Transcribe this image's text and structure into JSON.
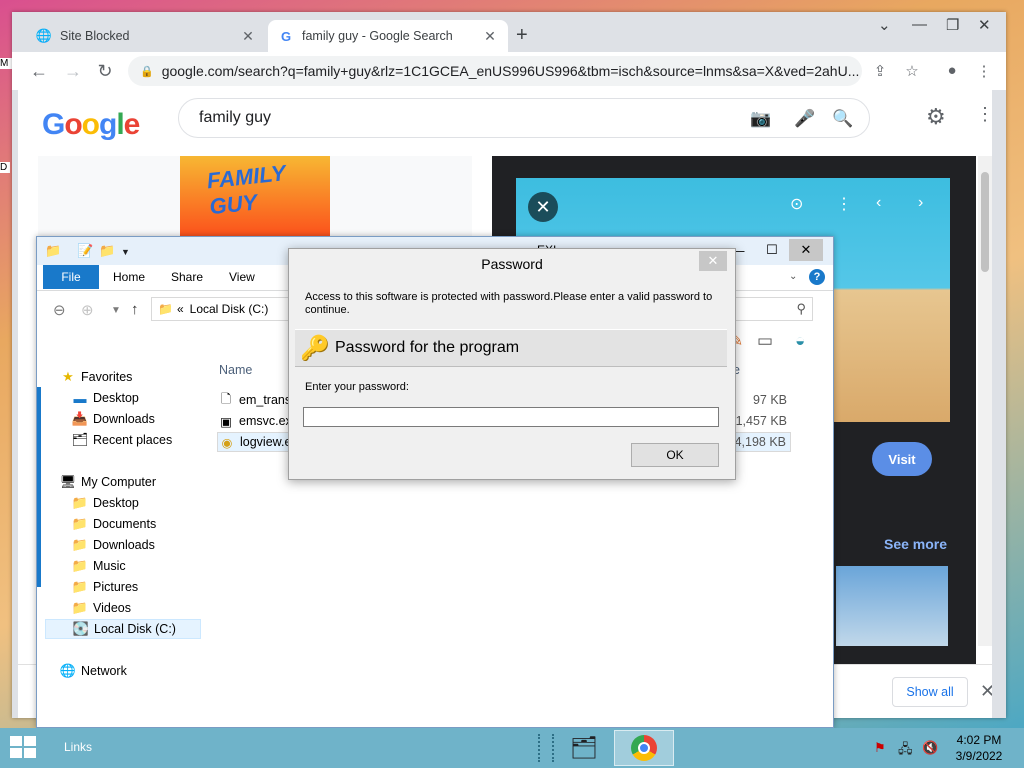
{
  "desktop": {
    "edge_letter_top": "M",
    "edge_letter_mid": "D"
  },
  "chrome": {
    "tabs": [
      {
        "title": "Site Blocked",
        "icon": "globe-icon"
      },
      {
        "title": "family guy - Google Search",
        "icon": "google-g-icon"
      }
    ],
    "url": "google.com/search?q=family+guy&rlz=1C1GCEA_enUS996US996&tbm=isch&source=lnms&sa=X&ved=2ahU...",
    "google_logo": "Google",
    "search_query": "family guy",
    "thumbnail_text": "FAMILY GUY",
    "visit_label": "Visit",
    "see_more_label": "See more",
    "show_all_label": "Show all"
  },
  "explorer": {
    "title_partial": "EXI",
    "ribbon_tabs": [
      "File",
      "Home",
      "Share",
      "View"
    ],
    "address": "Local Disk (C:)",
    "address_prefix": "«",
    "columns": {
      "name": "Name",
      "right": "e"
    },
    "nav": {
      "favorites": "Favorites",
      "fav_items": [
        "Desktop",
        "Downloads",
        "Recent places"
      ],
      "computer": "My Computer",
      "computer_items": [
        "Desktop",
        "Documents",
        "Downloads",
        "Music",
        "Pictures",
        "Videos",
        "Local Disk (C:)"
      ],
      "network": "Network"
    },
    "files": [
      {
        "name": "em_trans",
        "size": "97 KB"
      },
      {
        "name": "emsvc.ex",
        "size": "1,457 KB"
      },
      {
        "name": "logview.e",
        "size": "4,198 KB"
      }
    ]
  },
  "dialog": {
    "title": "Password",
    "message": "Access to this software is protected with password.Please enter a valid password to continue.",
    "band_text": "Password for the program",
    "label": "Enter your password:",
    "input_value": "",
    "ok_label": "OK"
  },
  "taskbar": {
    "links_label": "Links",
    "time": "4:02 PM",
    "date": "3/9/2022"
  }
}
